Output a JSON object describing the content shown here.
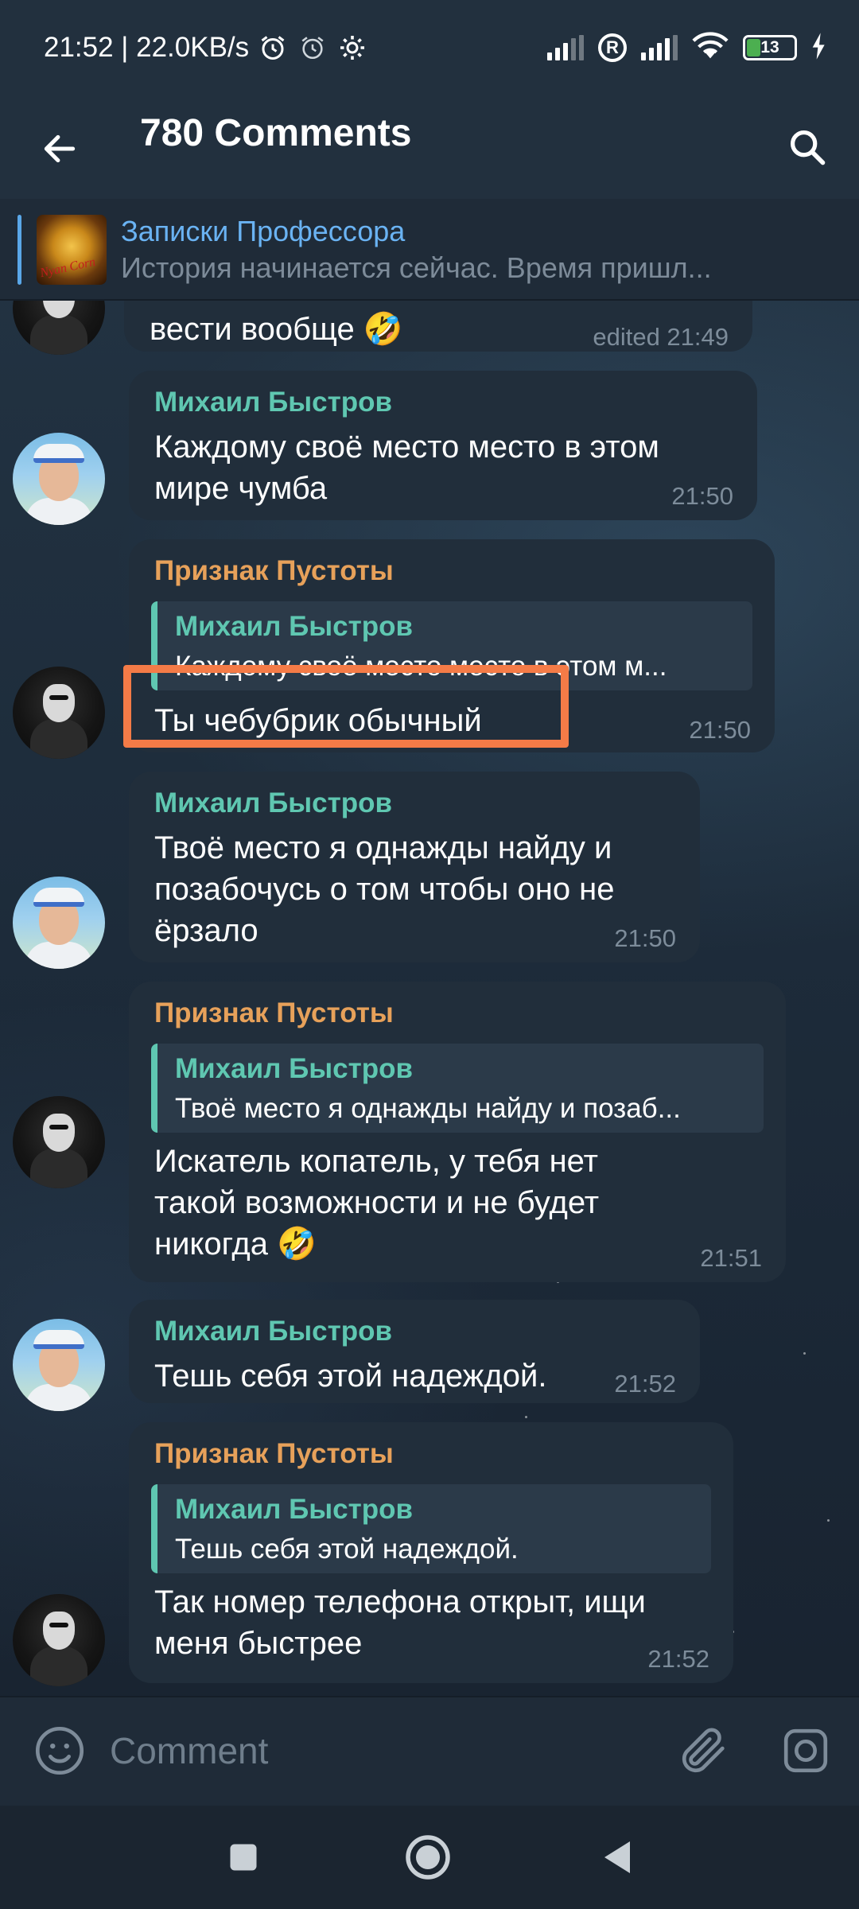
{
  "status_bar": {
    "time_speed": "21:52 | 22.0KB/s",
    "battery": "13"
  },
  "header": {
    "title": "780 Comments"
  },
  "pinned": {
    "title": "Записки Профессора",
    "text": "История начинается сейчас. Время пришл...",
    "thumb_stamp": "Nyan Corn"
  },
  "messages": [
    {
      "text": "вести вообще 🤣",
      "time": "edited 21:49"
    },
    {
      "sender": "Михаил Быстров",
      "text": "Каждому своё место место в этом\nмире чумба",
      "time": "21:50"
    },
    {
      "sender": "Признак Пустоты",
      "reply_name": "Михаил Быстров",
      "reply_text": "Каждому своё место место в этом м...",
      "text": "Ты чебубрик обычный",
      "time": "21:50"
    },
    {
      "sender": "Михаил Быстров",
      "text": "Твоё место я однажды найду и\nпозабочусь о том чтобы оно не\nёрзало",
      "time": "21:50"
    },
    {
      "sender": "Признак Пустоты",
      "reply_name": "Михаил Быстров",
      "reply_text": "Твоё место я однажды найду и позаб...",
      "text": "Искатель копатель, у тебя нет\nтакой возможности и не будет\nникогда 🤣",
      "time": "21:51"
    },
    {
      "sender": "Михаил Быстров",
      "text": "Тешь себя этой надеждой.",
      "time": "21:52"
    },
    {
      "sender": "Признак Пустоты",
      "reply_name": "Михаил Быстров",
      "reply_text": "Тешь себя этой надеждой.",
      "text": "Так номер телефона открыт, ищи\nменя быстрее",
      "time": "21:52"
    }
  ],
  "composer": {
    "placeholder": "Comment"
  },
  "colors": {
    "accent": "#6ab3f3",
    "sender_green": "#5fc7b1",
    "sender_orange": "#e7a15a",
    "highlight": "#f47b47"
  }
}
